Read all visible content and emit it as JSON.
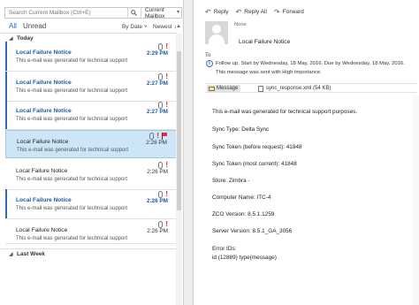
{
  "search": {
    "placeholder": "Search Current Mailbox (Ctrl+E)",
    "scope": "Current Mailbox"
  },
  "filters": {
    "all": "All",
    "unread": "Unread",
    "sort_by": "By Date ˅",
    "sort_order": "Newest ↓"
  },
  "groups": {
    "today": "Today",
    "last_week": "Last Week"
  },
  "messages": [
    {
      "sender": "Local Failure Notice",
      "preview": "This e-mail was generated for technical support",
      "time": "2:29 PM",
      "unread": true,
      "selected": false,
      "flagged": false
    },
    {
      "sender": "Local Failure Notice",
      "preview": "This e-mail was generated for technical support",
      "time": "2:27 PM",
      "unread": true,
      "selected": false,
      "flagged": false
    },
    {
      "sender": "Local Failure Notice",
      "preview": "This e-mail was generated for technical support",
      "time": "2:27 PM",
      "unread": true,
      "selected": false,
      "flagged": false
    },
    {
      "sender": "Local Failure Notice",
      "preview": "This e-mail was generated for technical support",
      "time": "2:26 PM",
      "unread": false,
      "selected": true,
      "flagged": true
    },
    {
      "sender": "Local Failure Notice",
      "preview": "This e-mail was generated for technical support",
      "time": "2:26 PM",
      "unread": false,
      "selected": false,
      "flagged": false
    },
    {
      "sender": "Local Failure Notice",
      "preview": "This e-mail was generated for technical support",
      "time": "2:26 PM",
      "unread": true,
      "selected": false,
      "flagged": false
    },
    {
      "sender": "Local Failure Notice",
      "preview": "This e-mail was generated for technical support",
      "time": "2:26 PM",
      "unread": false,
      "selected": false,
      "flagged": false
    }
  ],
  "reading": {
    "actions": {
      "reply": "Reply",
      "reply_all": "Reply All",
      "forward": "Forward"
    },
    "from": "None",
    "subject": "Local Failure Notice",
    "to_label": "To",
    "followup": "Follow up.  Start by Wednesday, 18 May, 2016.  Due by Wednesday, 18 May, 2016.",
    "importance": "This message was sent with High importance.",
    "tab_message": "Message",
    "attachment": "sync_response.xml (54 KB)",
    "body": [
      "This e-mail was generated for technical support purposes.",
      "Sync Type: Delta Sync",
      "Sync Token (before request): 41848",
      "Sync Token (most current): 41848",
      "Store: Zimbra -",
      "Computer Name: ITC-4",
      "ZCO Version: 8.5.1.1259",
      "Server Version: 8.5.1_GA_3056",
      "Error IDs:",
      "id (12889) type(message)"
    ]
  },
  "colors": {
    "accent": "#2a6ab5",
    "selected_bg": "#cde6f7",
    "importance": "#dd2222"
  }
}
